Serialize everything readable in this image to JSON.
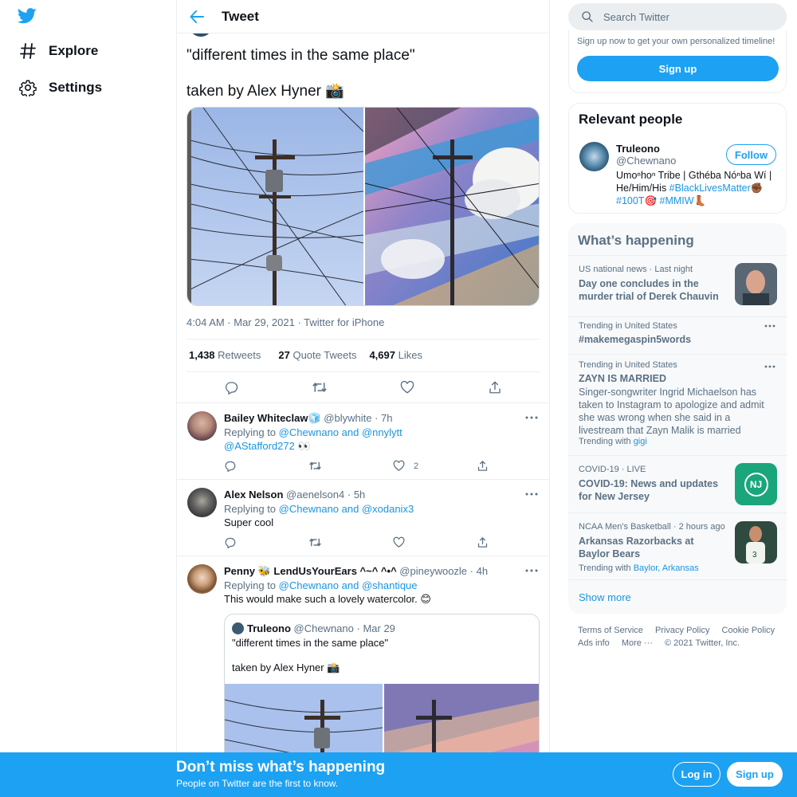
{
  "nav": {
    "explore": "Explore",
    "settings": "Settings"
  },
  "header": {
    "title": "Tweet"
  },
  "tweet": {
    "line1": "\"different times in the same place\"",
    "line2": "taken by Alex Hyner 📸",
    "timestamp": "4:04 AM · Mar 29, 2021 · Twitter for iPhone",
    "retweets_count": "1,438",
    "retweets_label": "Retweets",
    "quotes_count": "27",
    "quotes_label": "Quote Tweets",
    "likes_count": "4,697",
    "likes_label": "Likes"
  },
  "replies": [
    {
      "name": "Bailey Whiteclaw🧊",
      "handle": "@blywhite",
      "time": "· 7h",
      "replying_prefix": "Replying to",
      "replying_to": "@Chewnano and @nnylytt",
      "text_link": "@AStafford272",
      "text": " 👀",
      "likes": "2"
    },
    {
      "name": "Alex Nelson",
      "handle": "@aenelson4",
      "time": "· 5h",
      "replying_prefix": "Replying to",
      "replying_to": "@Chewnano and @xodanix3",
      "text": "Super cool",
      "likes": ""
    },
    {
      "name": "Penny 🐝 LendUsYourEars ^~^ ^•^",
      "handle": "@pineywoozle",
      "time": "· 4h",
      "replying_prefix": "Replying to",
      "replying_to": "@Chewnano and @shantique",
      "text": "This would make such a lovely watercolor. 😊",
      "quote": {
        "name": "Truleono",
        "handle": "@Chewnano",
        "time": "· Mar 29",
        "line1": "\"different times in the same place\"",
        "line2": "taken by Alex Hyner 📸"
      }
    }
  ],
  "search": {
    "placeholder": "Search Twitter"
  },
  "signup_card": {
    "text": "Sign up now to get your own personalized timeline!",
    "button": "Sign up"
  },
  "relevant": {
    "title": "Relevant people",
    "name": "Truleono",
    "handle": "@Chewnano",
    "follow": "Follow",
    "bio_line1": "Umoⁿhoⁿ Tribe | Gthéba Nóⁿba Wí |",
    "bio_line2_text": "He/Him/His ",
    "bio_line2_link": "#BlackLivesMatter",
    "bio_line2_emoji": "✊🏾",
    "bio_line3_link1": "#100T",
    "bio_line3_emoji1": "🎯",
    "bio_line3_link2": "#MMIW",
    "bio_line3_emoji2": "👢"
  },
  "happening": {
    "title": "What’s happening",
    "trends": [
      {
        "context": "US national news · Last night",
        "title": "Day one concludes in the murder trial of Derek Chauvin"
      },
      {
        "context": "Trending in United States",
        "title": "#makemegaspin5words"
      },
      {
        "context": "Trending in United States",
        "title": "ZAYN IS MARRIED",
        "desc": "Singer-songwriter Ingrid Michaelson has taken to Instagram to apologize and admit she was wrong when she said in a livestream that Zayn Malik is married",
        "trending_with_label": "Trending with",
        "trending_with": "gigi"
      },
      {
        "context": "COVID-19 · LIVE",
        "title": "COVID-19: News and updates for New Jersey",
        "badge": "NJ"
      },
      {
        "context": "NCAA Men's Basketball · 2 hours ago",
        "title": "Arkansas Razorbacks at Baylor Bears",
        "trending_with_label": "Trending with",
        "trending_with": "Baylor, Arkansas"
      }
    ],
    "show_more": "Show more"
  },
  "footer": {
    "terms": "Terms of Service",
    "privacy": "Privacy Policy",
    "cookie": "Cookie Policy",
    "ads": "Ads info",
    "more": "More ···",
    "copyright": "© 2021 Twitter, Inc."
  },
  "bottom_bar": {
    "title": "Don’t miss what’s happening",
    "subtitle": "People on Twitter are the first to know.",
    "login": "Log in",
    "signup": "Sign up"
  },
  "colors": {
    "accent": "#1da1f2",
    "link": "#1b95e0",
    "text": "#0f1419",
    "secondary": "#5b7083"
  }
}
